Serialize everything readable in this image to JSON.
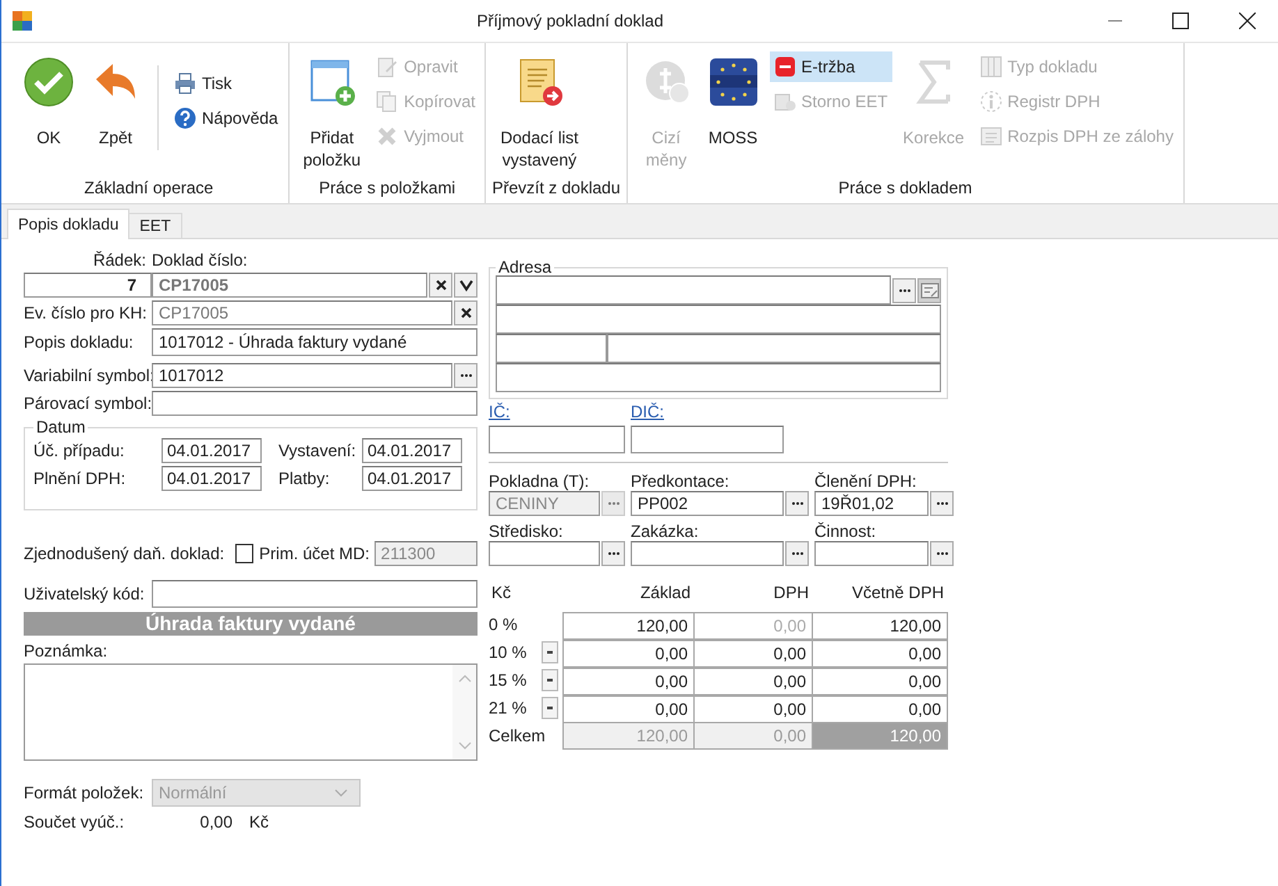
{
  "window": {
    "title": "Příjmový pokladní doklad"
  },
  "ribbon": {
    "groups": [
      {
        "label": "Základní operace",
        "columns": [
          {
            "kind": "large",
            "items": [
              {
                "lines": [
                  "OK"
                ],
                "disabled": false,
                "highlighted": false
              },
              {
                "lines": [
                  "Zpět"
                ],
                "disabled": false,
                "highlighted": false
              }
            ]
          },
          {
            "kind": "small",
            "items": [
              {
                "lines": [
                  "Tisk"
                ],
                "disabled": false,
                "highlighted": false
              },
              {
                "lines": [
                  "Nápověda"
                ],
                "disabled": false,
                "highlighted": false
              }
            ]
          }
        ]
      },
      {
        "label": "Práce s položkami",
        "columns": [
          {
            "kind": "large",
            "items": [
              {
                "lines": [
                  "Přidat",
                  "položku"
                ],
                "disabled": false,
                "highlighted": false
              }
            ]
          },
          {
            "kind": "small",
            "items": [
              {
                "lines": [
                  "Opravit"
                ],
                "disabled": true,
                "highlighted": false
              },
              {
                "lines": [
                  "Kopírovat"
                ],
                "disabled": true,
                "highlighted": false
              },
              {
                "lines": [
                  "Vyjmout"
                ],
                "disabled": true,
                "highlighted": false
              }
            ]
          }
        ]
      },
      {
        "label": "Převzít z dokladu",
        "columns": [
          {
            "kind": "large",
            "items": [
              {
                "lines": [
                  "Dodací list",
                  "vystavený"
                ],
                "disabled": false,
                "highlighted": false
              }
            ]
          }
        ]
      },
      {
        "label": "Práce s dokladem",
        "columns": [
          {
            "kind": "large",
            "items": [
              {
                "lines": [
                  "Cizí",
                  "měny"
                ],
                "disabled": true,
                "highlighted": false
              },
              {
                "lines": [
                  "MOSS"
                ],
                "disabled": false,
                "highlighted": false
              }
            ]
          },
          {
            "kind": "small",
            "items": [
              {
                "lines": [
                  "E-tržba"
                ],
                "disabled": false,
                "highlighted": true
              },
              {
                "lines": [
                  "Storno EET"
                ],
                "disabled": true,
                "highlighted": false
              }
            ]
          },
          {
            "kind": "large",
            "items": [
              {
                "lines": [
                  "Korekce"
                ],
                "disabled": true,
                "highlighted": false
              }
            ]
          },
          {
            "kind": "small",
            "items": [
              {
                "lines": [
                  "Typ dokladu"
                ],
                "disabled": true,
                "highlighted": false
              },
              {
                "lines": [
                  "Registr DPH"
                ],
                "disabled": true,
                "highlighted": false
              },
              {
                "lines": [
                  "Rozpis DPH ze zálohy"
                ],
                "disabled": true,
                "highlighted": false
              }
            ]
          }
        ]
      }
    ]
  },
  "tabs": [
    {
      "label": "Popis dokladu",
      "selected": true
    },
    {
      "label": "EET",
      "selected": false
    }
  ],
  "left": {
    "radek": {
      "label": "Řádek:",
      "value": "7"
    },
    "doklad_cislo": {
      "label": "Doklad číslo:",
      "value": "CP17005"
    },
    "ev_cislo_kh": {
      "label": "Ev. číslo pro KH:",
      "value": "CP17005"
    },
    "popis": {
      "label": "Popis dokladu:",
      "value": "1017012 - Úhrada faktury vydané"
    },
    "variabilni_symbol": {
      "label": "Variabilní symbol:",
      "value": "1017012"
    },
    "parovaci_symbol": {
      "label": "Párovací symbol:"
    },
    "datum": {
      "title": "Datum",
      "fields": [
        {
          "label": "Úč. případu:",
          "value": "04.01.2017"
        },
        {
          "label": "Vystavení:",
          "value": "04.01.2017"
        },
        {
          "label": "Plnění DPH:",
          "value": "04.01.2017"
        },
        {
          "label": "Platby:",
          "value": "04.01.2017"
        }
      ]
    },
    "zjednoduseny": {
      "label": "Zjednodušený daň. doklad:",
      "checked": false
    },
    "prim_ucet": {
      "label": "Prim. účet MD:",
      "value": "211300",
      "disabled": true
    },
    "uzivatelsky_kod": {
      "label": "Uživatelský kód:"
    },
    "banner": "Úhrada faktury vydané",
    "poznamka": {
      "label": "Poznámka:"
    },
    "format_polozek": {
      "label": "Formát položek:",
      "value": "Normální",
      "disabled": true
    },
    "soucet": {
      "label": "Součet vyúč.:",
      "value": "0,00",
      "unit": "Kč"
    }
  },
  "right": {
    "adresa": {
      "title": "Adresa"
    },
    "ic": {
      "label": "IČ:"
    },
    "dic": {
      "label": "DIČ:"
    },
    "accounting_fields": [
      {
        "label": "Pokladna (T):",
        "value": "CENINY",
        "disabled": true
      },
      {
        "label": "Předkontace:",
        "value": "PP002",
        "disabled": false
      },
      {
        "label": "Členění DPH:",
        "value": "19Ř01,02",
        "disabled": false
      },
      {
        "label": "Středisko:",
        "disabled": false
      },
      {
        "label": "Zakázka:",
        "disabled": false
      },
      {
        "label": "Činnost:",
        "disabled": false
      }
    ],
    "vat_table": {
      "corner": "Kč",
      "columns": [
        "Základ",
        "DPH",
        "Včetně DPH"
      ],
      "rows": [
        {
          "rate": "0 %",
          "dropdown": false,
          "cells": [
            {
              "value": "120,00",
              "disabled": false
            },
            {
              "value": "0,00",
              "disabled": true
            },
            {
              "value": "120,00",
              "disabled": false
            }
          ]
        },
        {
          "rate": "10 %",
          "dropdown": true,
          "cells": [
            {
              "value": "0,00",
              "disabled": false
            },
            {
              "value": "0,00",
              "disabled": false
            },
            {
              "value": "0,00",
              "disabled": false
            }
          ]
        },
        {
          "rate": "15 %",
          "dropdown": true,
          "cells": [
            {
              "value": "0,00",
              "disabled": false
            },
            {
              "value": "0,00",
              "disabled": false
            },
            {
              "value": "0,00",
              "disabled": false
            }
          ]
        },
        {
          "rate": "21 %",
          "dropdown": true,
          "cells": [
            {
              "value": "0,00",
              "disabled": false
            },
            {
              "value": "0,00",
              "disabled": false
            },
            {
              "value": "0,00",
              "disabled": false
            }
          ]
        }
      ],
      "total": {
        "label": "Celkem",
        "cells": [
          "120,00",
          "0,00",
          "120,00"
        ]
      }
    }
  }
}
